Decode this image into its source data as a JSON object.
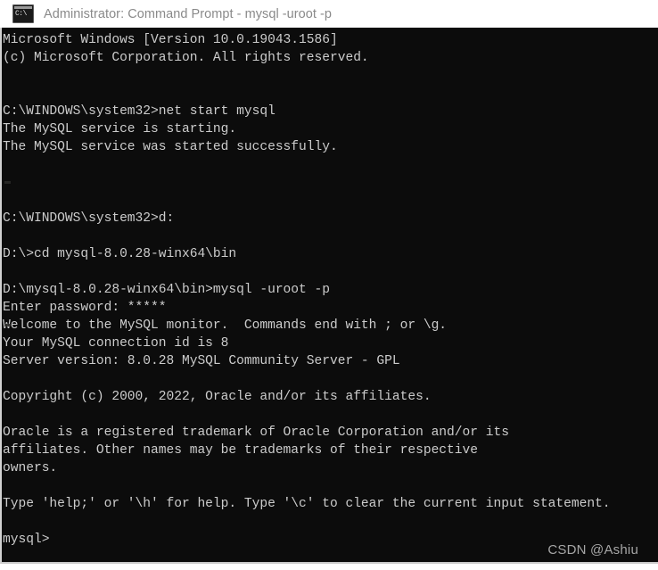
{
  "window": {
    "title": "Administrator: Command Prompt - mysql  -uroot -p",
    "icon": "cmd-icon",
    "icon_glyph": "C:\\",
    "titlebar_bg": "#ffffff",
    "titlebar_fg": "#8a8a8a"
  },
  "console": {
    "background": "#0c0c0c",
    "foreground": "#cccccc",
    "lines": [
      "Microsoft Windows [Version 10.0.19043.1586]",
      "(c) Microsoft Corporation. All rights reserved.",
      "",
      "",
      "C:\\WINDOWS\\system32>net start mysql",
      "The MySQL service is starting.",
      "The MySQL service was started successfully.",
      "",
      "",
      "",
      "C:\\WINDOWS\\system32>d:",
      "",
      "D:\\>cd mysql-8.0.28-winx64\\bin",
      "",
      "D:\\mysql-8.0.28-winx64\\bin>mysql -uroot -p",
      "Enter password: *****",
      "Welcome to the MySQL monitor.  Commands end with ; or \\g.",
      "Your MySQL connection id is 8",
      "Server version: 8.0.28 MySQL Community Server - GPL",
      "",
      "Copyright (c) 2000, 2022, Oracle and/or its affiliates.",
      "",
      "Oracle is a registered trademark of Oracle Corporation and/or its",
      "affiliates. Other names may be trademarks of their respective",
      "owners.",
      "",
      "Type 'help;' or '\\h' for help. Type '\\c' to clear the current input statement.",
      "",
      "mysql>"
    ]
  },
  "watermark": {
    "text": "CSDN @Ashiu",
    "color": "#a6a6a6"
  }
}
